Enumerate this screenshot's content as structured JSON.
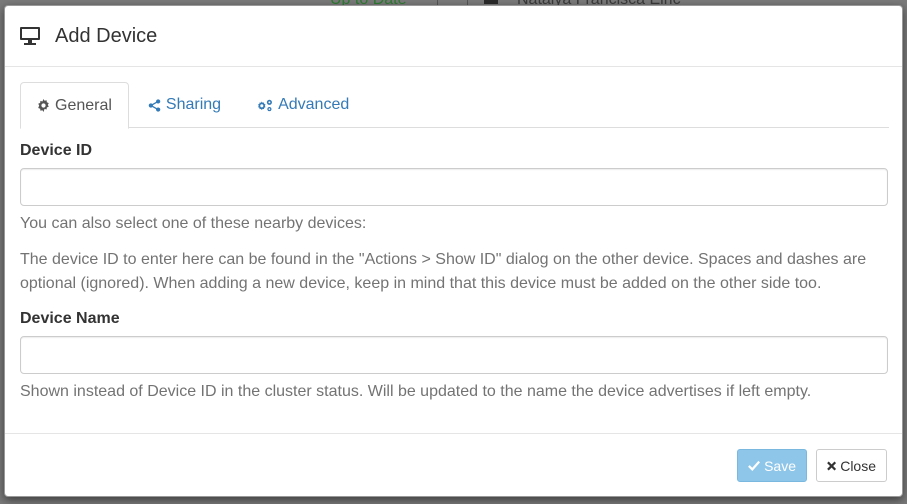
{
  "background": {
    "status_text": "Up to Date",
    "user_text": "Natalya Francisca Elric"
  },
  "modal": {
    "title": "Add Device",
    "tabs": [
      {
        "label": "General",
        "icon": "gear-icon",
        "active": true
      },
      {
        "label": "Sharing",
        "icon": "share-icon",
        "active": false
      },
      {
        "label": "Advanced",
        "icon": "gears-icon",
        "active": false
      }
    ],
    "device_id": {
      "label": "Device ID",
      "value": "",
      "nearby_hint": "You can also select one of these nearby devices:",
      "help": "The device ID to enter here can be found in the \"Actions > Show ID\" dialog on the other device. Spaces and dashes are optional (ignored). When adding a new device, keep in mind that this device must be added on the other side too."
    },
    "device_name": {
      "label": "Device Name",
      "value": "",
      "help": "Shown instead of Device ID in the cluster status. Will be updated to the name the device advertises if left empty."
    },
    "footer": {
      "save_label": "Save",
      "close_label": "Close"
    }
  },
  "colors": {
    "link": "#337ab7",
    "save_button_bg": "#8ec6ea",
    "backdrop": "#7a7a7a"
  }
}
